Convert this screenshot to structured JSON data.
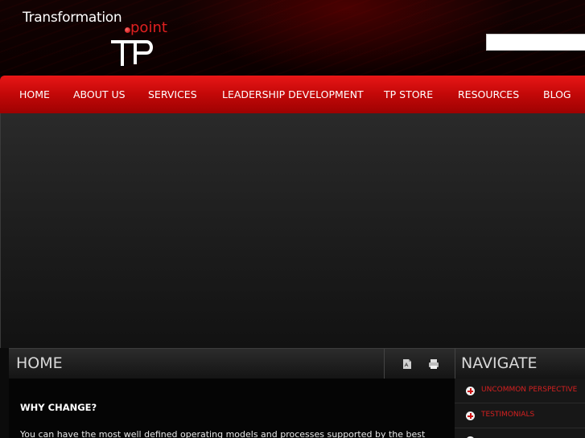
{
  "header": {
    "logo": {
      "line1": "Transformation",
      "line2": "point",
      "mark": "TP"
    },
    "search": {
      "value": "",
      "placeholder": ""
    }
  },
  "nav": {
    "items": [
      {
        "label": "HOME"
      },
      {
        "label": "ABOUT US"
      },
      {
        "label": "SERVICES"
      },
      {
        "label": "LEADERSHIP DEVELOPMENT"
      },
      {
        "label": "TP STORE"
      },
      {
        "label": "RESOURCES"
      },
      {
        "label": "BLOG"
      }
    ]
  },
  "content": {
    "title": "HOME",
    "tools": {
      "pdf_icon": "pdf-icon",
      "print_icon": "print-icon"
    },
    "heading": "WHY CHANGE?",
    "paragraph": "You can have the most well defined operating models and processes supported by the best"
  },
  "sidebar": {
    "title": "NAVIGATE",
    "items": [
      {
        "label": "UNCOMMON PERSPECTIVE"
      },
      {
        "label": "TESTIMONIALS"
      },
      {
        "label": ""
      }
    ]
  },
  "colors": {
    "accent": "#d41414",
    "nav_top": "#e81616",
    "nav_bottom": "#9e0202",
    "background": "#0b0b0b"
  }
}
